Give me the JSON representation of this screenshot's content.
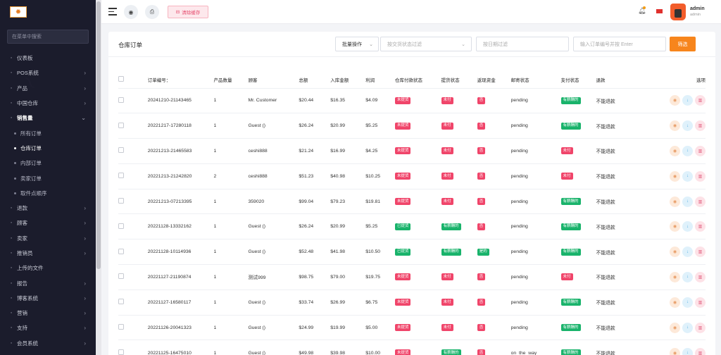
{
  "sidebar": {
    "search_placeholder": "在菜单中搜索",
    "items": [
      {
        "icon": "dashboard-icon",
        "label": "仪表板",
        "chev": ""
      },
      {
        "icon": "pos-icon",
        "label": "POS系统",
        "chev": "›"
      },
      {
        "icon": "product-icon",
        "label": "产品",
        "chev": "›"
      },
      {
        "icon": "warehouse-icon",
        "label": "中国仓库",
        "chev": "›"
      },
      {
        "icon": "sales-icon",
        "label": "销售量",
        "chev": "⌄"
      }
    ],
    "sub_items": [
      "所有订单",
      "仓库订单",
      "内部订单",
      "卖家订单",
      "取件点顺序"
    ],
    "items_after": [
      {
        "icon": "refund-icon",
        "label": "退款",
        "chev": "›"
      },
      {
        "icon": "customer-icon",
        "label": "顾客",
        "chev": "›"
      },
      {
        "icon": "seller-icon",
        "label": "卖家",
        "chev": "›"
      },
      {
        "icon": "affiliate-icon",
        "label": "推销员",
        "chev": "›"
      },
      {
        "icon": "upload-icon",
        "label": "上传的文件",
        "chev": ""
      },
      {
        "icon": "report-icon",
        "label": "报告",
        "chev": "›"
      },
      {
        "icon": "blog-icon",
        "label": "博客系统",
        "chev": "›"
      },
      {
        "icon": "marketing-icon",
        "label": "营销",
        "chev": "›"
      },
      {
        "icon": "support-icon",
        "label": "支持",
        "chev": "›"
      },
      {
        "icon": "member-icon",
        "label": "会员系统",
        "chev": "›"
      }
    ]
  },
  "header": {
    "clear_cache": "清除缓存",
    "user_name": "admin",
    "user_role": "admin"
  },
  "card": {
    "title": "仓库订单",
    "batch_label": "批量操作",
    "delivery_filter_placeholder": "按交货状态过滤",
    "date_filter_placeholder": "按日期过滤",
    "search_placeholder": "输入订单编号并按 Enter",
    "filter_button": "筛选"
  },
  "table": {
    "headers": [
      "订单编号：",
      "产品数量",
      "顾客",
      "总额",
      "入库金额",
      "利润",
      "仓库付款状态",
      "提货状态",
      "返现资金",
      "邮寄状态",
      "支付状态",
      "退款",
      "选项"
    ],
    "rows": [
      [
        "20241210-21143465",
        "1",
        "Mr. Customer",
        "$20.44",
        "$16.35",
        "$4.09",
        "未提货",
        "未付",
        "否",
        "pending",
        "有薪酬的",
        "不能退款"
      ],
      [
        "20221217-17280118",
        "1",
        "Guest ()",
        "$26.24",
        "$20.99",
        "$5.25",
        "未提货",
        "未付",
        "否",
        "pending",
        "有薪酬的",
        "不能退款"
      ],
      [
        "20221213-21465583",
        "1",
        "ceshi888",
        "$21.24",
        "$16.99",
        "$4.25",
        "未提货",
        "未付",
        "否",
        "pending",
        "未付",
        "不能退款"
      ],
      [
        "20221213-21242820",
        "2",
        "ceshi888",
        "$51.23",
        "$40.98",
        "$10.25",
        "未提货",
        "未付",
        "否",
        "pending",
        "未付",
        "不能退款"
      ],
      [
        "20221213-07213395",
        "1",
        "359020",
        "$99.04",
        "$79.23",
        "$19.81",
        "未提货",
        "未付",
        "否",
        "pending",
        "有薪酬的",
        "不能退款"
      ],
      [
        "20221128-13332162",
        "1",
        "Guest ()",
        "$26.24",
        "$20.99",
        "$5.25",
        "已提货",
        "有薪酬的",
        "否",
        "pending",
        "有薪酬的",
        "不能退款"
      ],
      [
        "20221128-10114936",
        "1",
        "Guest ()",
        "$52.48",
        "$41.98",
        "$10.50",
        "已提货",
        "有薪酬的",
        "是的",
        "pending",
        "有薪酬的",
        "不能退款"
      ],
      [
        "20221127-21190874",
        "1",
        "测试999",
        "$98.75",
        "$79.00",
        "$19.75",
        "未提货",
        "未付",
        "否",
        "pending",
        "未付",
        "不能退款"
      ],
      [
        "20221127-16580117",
        "1",
        "Guest ()",
        "$33.74",
        "$26.99",
        "$6.75",
        "未提货",
        "未付",
        "否",
        "pending",
        "有薪酬的",
        "不能退款"
      ],
      [
        "20221126-20041323",
        "1",
        "Guest ()",
        "$24.99",
        "$19.99",
        "$5.00",
        "未提货",
        "未付",
        "否",
        "pending",
        "有薪酬的",
        "不能退款"
      ],
      [
        "20221125-16475010",
        "1",
        "Guest ()",
        "$49.98",
        "$39.98",
        "$10.00",
        "未提货",
        "有薪酬的",
        "否",
        "on_the_way",
        "有薪酬的",
        "不能退款"
      ]
    ]
  },
  "colors": {
    "accent": "#f7851c",
    "sidebar_bg": "#1b1c2c",
    "tag_red": "#f0456a",
    "tag_green": "#19b36b"
  }
}
